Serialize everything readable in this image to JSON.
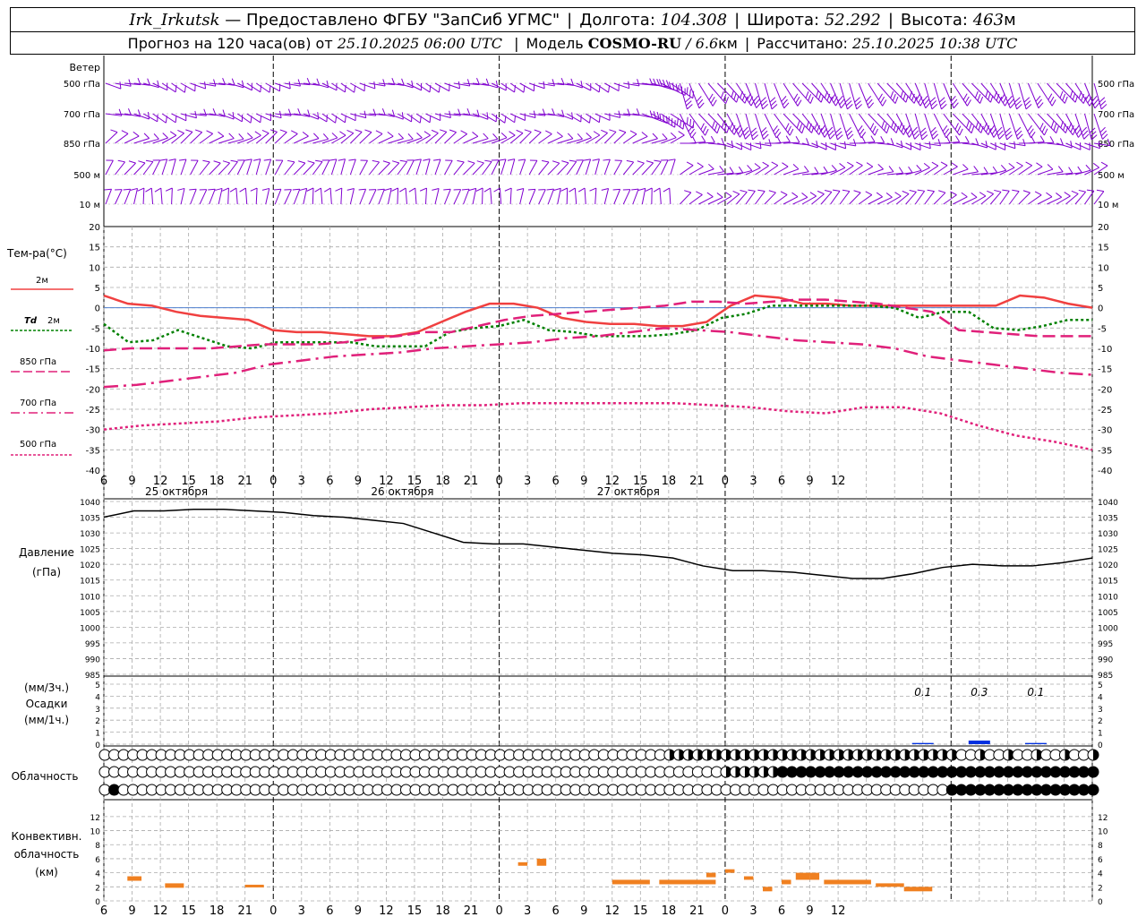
{
  "header": {
    "station": "Irk_Irkutsk",
    "provider": "— Предоставлено ФГБУ \"ЗапСиб УГМС\"",
    "lon_label": "Долгота:",
    "lon": "104.308",
    "lat_label": "Широта:",
    "lat": "52.292",
    "alt_label": "Высота:",
    "alt": "463",
    "alt_unit": "м"
  },
  "subheader": {
    "forecast_label": "Прогноз на 120 часа(ов) от",
    "start": "25.10.2025 06:00 UTC",
    "model_label": "Модель",
    "model": "COSMO-RU",
    "model_res": "/ 6.6",
    "model_res_unit": "км",
    "calc_label": "Рассчитано:",
    "calc": "25.10.2025 10:38 UTC"
  },
  "colors": {
    "t2m": "#f04040",
    "td": "#008000",
    "t850": "#e0207a",
    "t700": "#e0207a",
    "t500": "#e0207a",
    "wind": "#8000d0",
    "pressure": "#000000",
    "precip": "#0030e0",
    "convective": "#f08020",
    "grid": "#aaaaaa"
  },
  "chart_data": [
    {
      "type": "wind_barbs",
      "title": "Ветер",
      "levels": [
        "500 гПа",
        "700 гПа",
        "850 гПа",
        "500 м",
        "10 м"
      ],
      "grid": true
    },
    {
      "type": "line",
      "ylabel": "Тем-ра(°C)",
      "ylim": [
        -40,
        20
      ],
      "yticks": [
        20,
        15,
        10,
        5,
        0,
        -5,
        -10,
        -15,
        -20,
        -25,
        -30,
        -35,
        -40
      ],
      "x_hours_from_start": [
        0,
        1,
        2,
        4,
        6,
        8,
        10,
        12,
        14,
        16,
        18,
        20,
        22,
        24,
        27,
        30,
        33,
        36,
        39,
        42,
        45,
        48,
        51,
        54,
        57,
        60,
        63,
        66,
        69,
        72,
        75,
        78,
        81,
        84,
        87,
        90,
        93,
        96,
        99,
        102,
        105
      ],
      "series": [
        {
          "name": "2м",
          "style": "solid",
          "values": [
            3,
            1,
            0.5,
            -1,
            -2,
            -2.5,
            -3,
            -5.5,
            -6,
            -6,
            -6.5,
            -7,
            -7,
            -6,
            -3.5,
            -1,
            1,
            1,
            0,
            -2.5,
            -3.5,
            -4,
            -4,
            -4.5,
            -4.5,
            -3.5,
            0.5,
            3,
            2.5,
            1,
            1,
            0.5,
            0.5,
            0.5,
            0.5,
            0.5,
            0.5,
            0.5,
            3,
            2.5,
            1,
            0
          ]
        },
        {
          "name": "Td 2м",
          "style": "dotted",
          "values": [
            -4,
            -8.5,
            -8,
            -5.5,
            -7.5,
            -9.5,
            -10,
            -8.5,
            -8.5,
            -8.5,
            -8.5,
            -9.5,
            -9.5,
            -9.5,
            -6,
            -5,
            -4.5,
            -3,
            -5.5,
            -6,
            -7,
            -7,
            -7,
            -6.5,
            -5.5,
            -2.5,
            -1.5,
            0.5,
            0.5,
            0.5,
            0.5,
            0.5,
            0,
            -2.5,
            -1,
            -1,
            -5,
            -5.5,
            -4.5,
            -3,
            -3
          ]
        },
        {
          "name": "850 гПа",
          "style": "dashed",
          "values": [
            -10.5,
            -10,
            -10,
            -10,
            -10,
            -9.5,
            -9,
            -9,
            -9,
            -8.5,
            -7.5,
            -7,
            -6,
            -6,
            -4.5,
            -3,
            -2,
            -1.5,
            -1,
            -0.5,
            0,
            0.5,
            1.5,
            1.5,
            1,
            1.5,
            2,
            2,
            1.5,
            1,
            0,
            -1,
            -5.5,
            -6,
            -6.5,
            -7,
            -7,
            -7
          ]
        },
        {
          "name": "700 гПа",
          "style": "dashdot",
          "values": [
            -19.5,
            -19,
            -18,
            -17,
            -16,
            -14,
            -13,
            -12,
            -11.5,
            -11,
            -10,
            -9.5,
            -9,
            -8.5,
            -7.5,
            -7,
            -6,
            -5,
            -5.5,
            -6,
            -7,
            -8,
            -8.5,
            -9,
            -10,
            -12,
            -13,
            -14,
            -15,
            -16,
            -16.5
          ]
        },
        {
          "name": "500 гПа",
          "style": "dotted",
          "values": [
            -30,
            -29,
            -28.5,
            -28,
            -27,
            -26.5,
            -26,
            -25,
            -24.5,
            -24,
            -24,
            -23.5,
            -23.5,
            -23.5,
            -23.5,
            -23.5,
            -24,
            -24.5,
            -25.5,
            -26,
            -24.5,
            -24.5,
            -26,
            -29,
            -31.5,
            -33,
            -35
          ]
        }
      ]
    },
    {
      "type": "line",
      "ylabel": "Давление",
      "yunit": "(гПа)",
      "ylim": [
        985,
        1040
      ],
      "yticks": [
        1040,
        1035,
        1030,
        1025,
        1020,
        1015,
        1010,
        1005,
        1000,
        995,
        990,
        985
      ],
      "series": [
        {
          "name": "Давление",
          "values": [
            1035,
            1037,
            1037,
            1037.5,
            1037.5,
            1037,
            1036.5,
            1035.5,
            1035,
            1034,
            1033,
            1030,
            1027,
            1026.5,
            1026.5,
            1025.5,
            1024.5,
            1023.5,
            1023,
            1022,
            1019.5,
            1018,
            1018,
            1017.5,
            1016.5,
            1015.5,
            1015.5,
            1017,
            1019,
            1020,
            1019.5,
            1019.5,
            1020.5,
            1022
          ]
        }
      ]
    },
    {
      "type": "bar",
      "ylabel": "Осадки",
      "yunit_top": "(мм/3ч.)",
      "yunit_bottom": "(мм/1ч.)",
      "ylim": [
        0,
        5
      ],
      "yticks": [
        5,
        4,
        3,
        2,
        1,
        0
      ],
      "annotations": [
        "0.1",
        "0.3",
        "0.1"
      ],
      "values_mm3h": [
        0.1,
        0.3,
        0.1
      ]
    },
    {
      "type": "cloud_cover",
      "ylabel": "Облачность",
      "rows": 3
    },
    {
      "type": "bar",
      "ylabel": "Конвективн. облачность (км)",
      "ylim": [
        0,
        13
      ],
      "yticks": [
        12,
        10,
        8,
        6,
        4,
        2,
        0
      ]
    }
  ],
  "axes": {
    "x_ticks": [
      "6",
      "9",
      "12",
      "15",
      "18",
      "21",
      "0",
      "3",
      "6",
      "9",
      "12",
      "15",
      "18",
      "21",
      "0",
      "3",
      "6",
      "9",
      "12",
      "15",
      "18",
      "21",
      "0",
      "3",
      "6",
      "9",
      "12"
    ],
    "dates": [
      "25 октября",
      "26 октября",
      "27 октября"
    ]
  },
  "legend": {
    "wind": "Ветер",
    "temp": "Тем-ра(°C)",
    "t2m": "2м",
    "td": "Td",
    "td_suffix": "2м",
    "t850": "850 гПа",
    "t700": "700 гПа",
    "t500": "500 гПа",
    "pres1": "Давление",
    "pres2": "(гПа)",
    "pr1": "(мм/3ч.)",
    "pr2": "Осадки",
    "pr3": "(мм/1ч.)",
    "cloud": "Облачность",
    "conv1": "Конвективн.",
    "conv2": "облачность",
    "conv3": "(км)"
  }
}
